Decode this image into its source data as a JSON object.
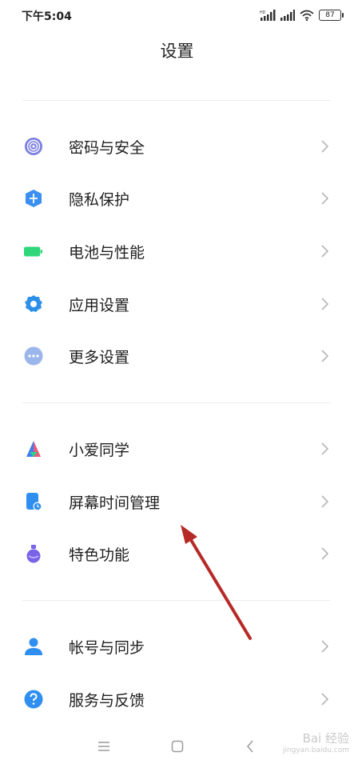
{
  "status_bar": {
    "time": "下午5:04",
    "battery": "87",
    "hd_label": "HD"
  },
  "header": {
    "title": "设置"
  },
  "groups": [
    {
      "items": [
        {
          "label": "密码与安全",
          "icon": "fingerprint-icon",
          "color": "#7b7fe0"
        },
        {
          "label": "隐私保护",
          "icon": "privacy-shield-icon",
          "color": "#3b8ff0"
        },
        {
          "label": "电池与性能",
          "icon": "battery-icon",
          "color": "#2fd67a"
        },
        {
          "label": "应用设置",
          "icon": "gear-icon",
          "color": "#2c8fe8"
        },
        {
          "label": "更多设置",
          "icon": "more-dots-icon",
          "color": "#9ab6ea"
        }
      ]
    },
    {
      "items": [
        {
          "label": "小爱同学",
          "icon": "xiaoai-icon",
          "color": "#e85a7a"
        },
        {
          "label": "屏幕时间管理",
          "icon": "screen-time-icon",
          "color": "#2f8ff0"
        },
        {
          "label": "特色功能",
          "icon": "flask-icon",
          "color": "#7a63e8"
        }
      ]
    },
    {
      "items": [
        {
          "label": "帐号与同步",
          "icon": "account-icon",
          "color": "#2f8ff0"
        },
        {
          "label": "服务与反馈",
          "icon": "help-icon",
          "color": "#2f8ff0"
        }
      ]
    }
  ],
  "nav_bar": {
    "menu_icon": "menu-icon",
    "home_icon": "home-icon",
    "back_icon": "back-icon"
  },
  "watermark": {
    "text": "Bai 经验",
    "sub": "jingyan.baidu.com"
  },
  "annotation": {
    "color": "#b52a26"
  }
}
